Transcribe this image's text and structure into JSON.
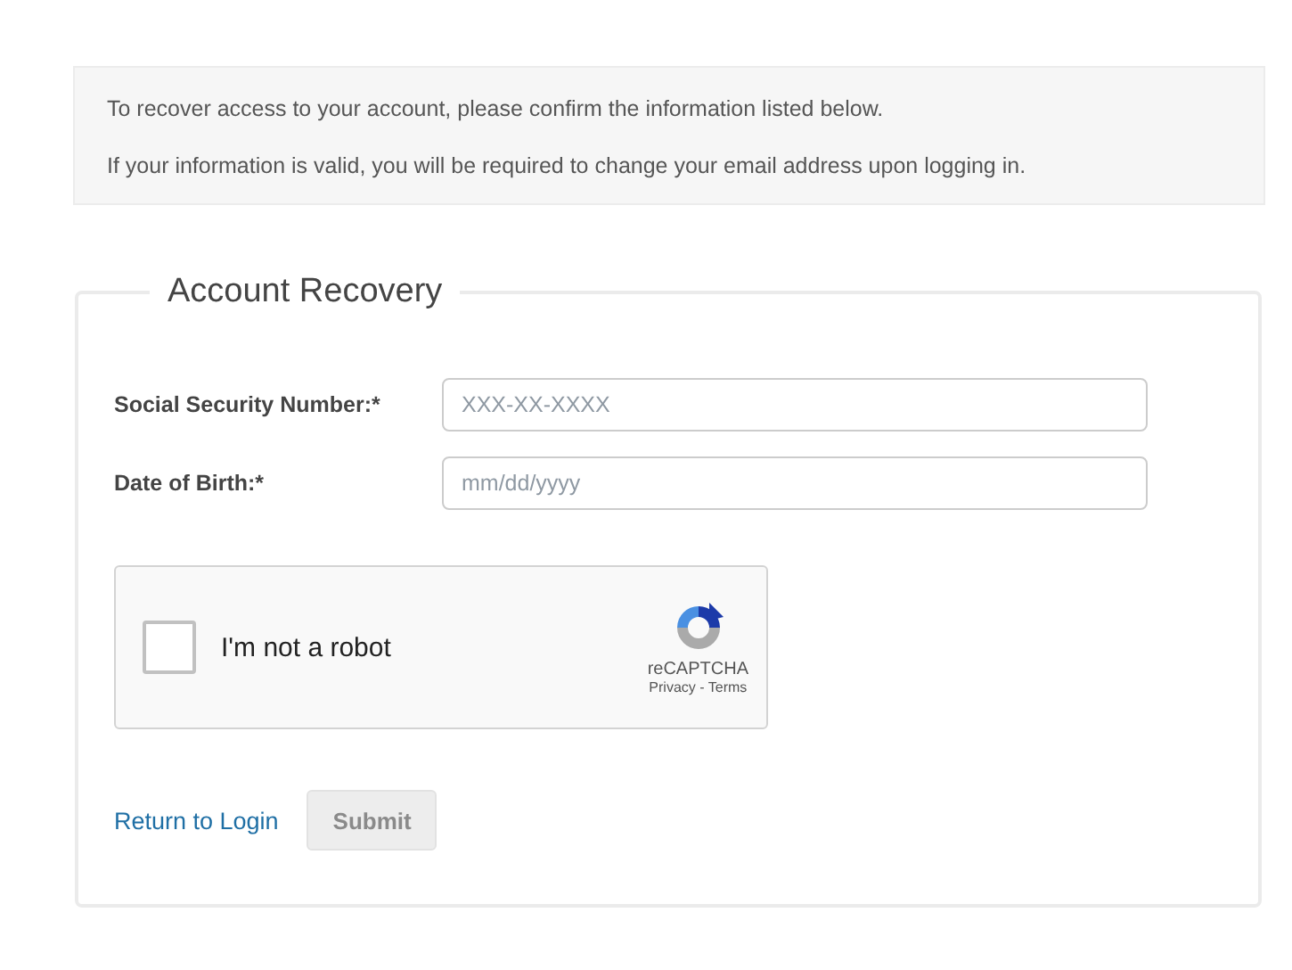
{
  "notice": [
    "To recover access to your account, please confirm the information listed below.",
    "If your information is valid, you will be required to change your email address upon logging in."
  ],
  "form": {
    "title": "Account Recovery",
    "fields": [
      {
        "label": "Social Security Number:*",
        "placeholder": "XXX-XX-XXXX"
      },
      {
        "label": "Date of Birth:*",
        "placeholder": "mm/dd/yyyy"
      }
    ],
    "captcha": {
      "checked": false,
      "label": "I'm not a robot",
      "brand": "reCAPTCHA",
      "links": "Privacy - Terms"
    },
    "return_link": "Return to Login",
    "submit": {
      "label": "Submit",
      "disabled": true
    }
  }
}
